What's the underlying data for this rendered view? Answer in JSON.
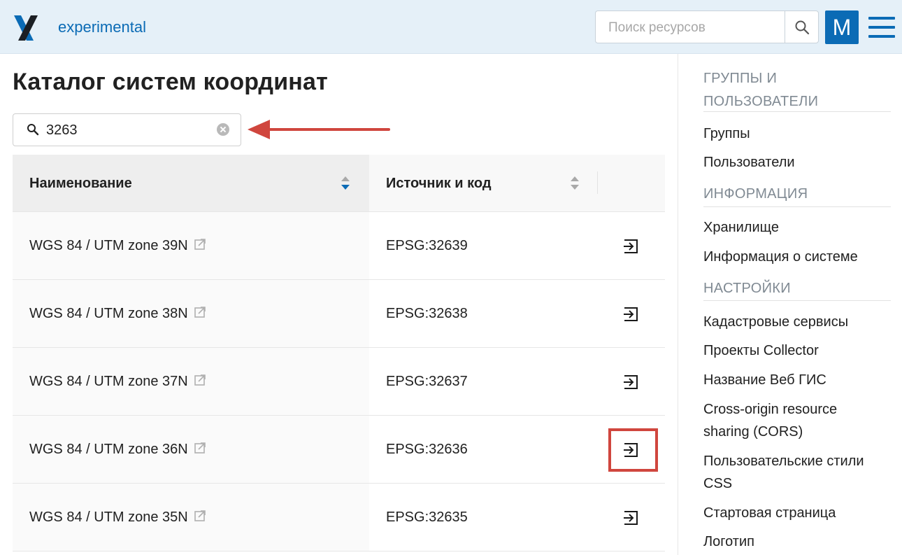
{
  "header": {
    "app_name": "experimental",
    "search_placeholder": "Поиск ресурсов",
    "avatar_letter": "M"
  },
  "main": {
    "title": "Каталог систем координат",
    "filter_value": "3263",
    "columns": [
      "Наименование",
      "Источник и код"
    ],
    "rows": [
      {
        "name": "WGS 84 / UTM zone 39N",
        "code": "EPSG:32639"
      },
      {
        "name": "WGS 84 / UTM zone 38N",
        "code": "EPSG:32638"
      },
      {
        "name": "WGS 84 / UTM zone 37N",
        "code": "EPSG:32637"
      },
      {
        "name": "WGS 84 / UTM zone 36N",
        "code": "EPSG:32636"
      },
      {
        "name": "WGS 84 / UTM zone 35N",
        "code": "EPSG:32635"
      }
    ]
  },
  "sidebar": {
    "groups_heading": "ГРУППЫ И ПОЛЬЗОВАТЕЛИ",
    "groups_items": [
      "Группы",
      "Пользователи"
    ],
    "info_heading": "ИНФОРМАЦИЯ",
    "info_items": [
      "Хранилище",
      "Информация о системе"
    ],
    "settings_heading": "НАСТРОЙКИ",
    "settings_items": [
      "Кадастровые сервисы",
      "Проекты Collector",
      "Название Веб ГИС",
      "Cross-origin resource sharing (CORS)",
      "Пользовательские стили CSS",
      "Стартовая страница",
      "Логотип"
    ]
  },
  "colors": {
    "header_bg": "#e5f0f8",
    "accent": "#0b6bb5",
    "annotation": "#d0463e"
  }
}
